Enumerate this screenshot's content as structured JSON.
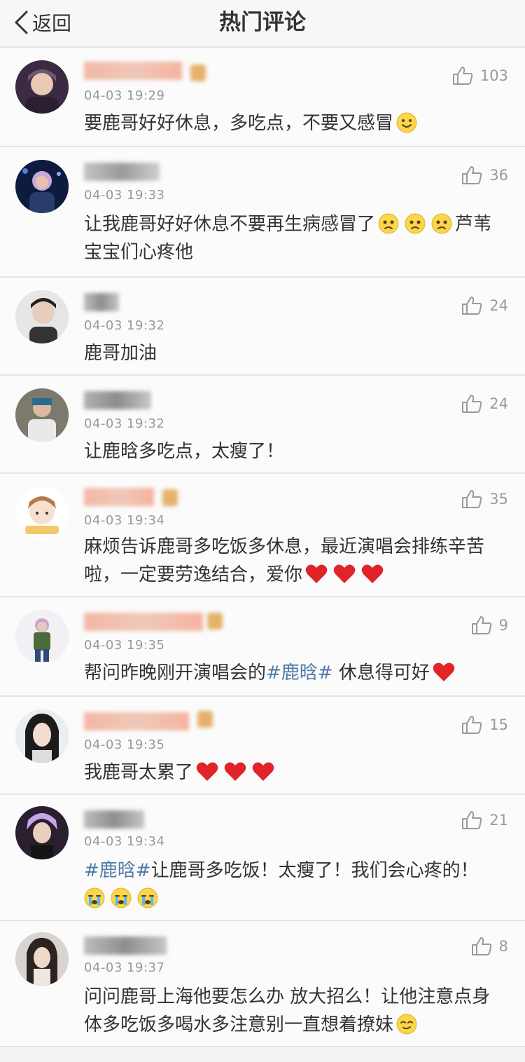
{
  "nav": {
    "back_label": "返回",
    "title": "热门评论"
  },
  "comments": [
    {
      "time": "04-03 19:29",
      "likes": "103",
      "text1": "要鹿哥好好休息，多吃点，不要又感冒",
      "emojis": [
        "smile"
      ]
    },
    {
      "time": "04-03 19:33",
      "likes": "36",
      "text1": "让我鹿哥好好休息不要再生病感冒了",
      "text2": "芦苇",
      "text3": "宝宝们心疼他",
      "emojis": [
        "sad",
        "sad",
        "sad"
      ]
    },
    {
      "time": "04-03 19:32",
      "likes": "24",
      "text1": "鹿哥加油"
    },
    {
      "time": "04-03 19:32",
      "likes": "24",
      "text1": "让鹿晗多吃点，太瘦了！"
    },
    {
      "time": "04-03 19:34",
      "likes": "35",
      "text1": "麻烦告诉鹿哥多吃饭多休息，最近演唱会排练辛苦",
      "text2": "啦，一定要劳逸结合，爱你",
      "emojis": [
        "heart",
        "heart",
        "heart"
      ]
    },
    {
      "time": "04-03 19:35",
      "likes": "9",
      "text1": "帮问昨晚刚开演唱会的",
      "topic": "#鹿晗#",
      "text2": " 休息得可好",
      "emojis": [
        "heart"
      ]
    },
    {
      "time": "04-03 19:35",
      "likes": "15",
      "text1": "我鹿哥太累了",
      "emojis": [
        "heart",
        "heart",
        "heart"
      ]
    },
    {
      "time": "04-03 19:34",
      "likes": "21",
      "topic": "#鹿晗#",
      "text1": "让鹿哥多吃饭！太瘦了！我们会心疼的！",
      "emojis": [
        "cry",
        "cry",
        "cry"
      ]
    },
    {
      "time": "04-03 19:37",
      "likes": "8",
      "text1": "问问鹿哥上海他要怎么办 放大招么！让他注意点身",
      "text2": "体多吃饭多喝水多注意别一直想着撩妹",
      "emojis": [
        "smug"
      ]
    }
  ],
  "colors": {
    "topic": "#4f7aa6",
    "heart": "#e0242a",
    "like_icon": "#9a9a9a"
  }
}
